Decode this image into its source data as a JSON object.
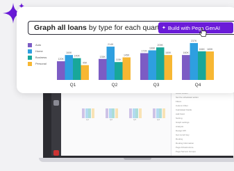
{
  "prompt": {
    "bold_text": "Graph all loans",
    "rest_text": "by type for each quarter",
    "button_label": "Build with Pega GenAI"
  },
  "colors": {
    "accent": "#6a1bd8",
    "auto": "#7c5cc4",
    "home": "#2e9fe0",
    "business": "#18a79a",
    "personal": "#f7b733"
  },
  "legend": [
    {
      "label": "Auto",
      "color": "#7c5cc4"
    },
    {
      "label": "Home",
      "color": "#2e9fe0"
    },
    {
      "label": "Business",
      "color": "#18a79a"
    },
    {
      "label": "Personal",
      "color": "#f7b733"
    }
  ],
  "chart_data": {
    "type": "bar",
    "categories": [
      "Q1",
      "Q2",
      "Q3",
      "Q4"
    ],
    "series": [
      {
        "name": "Auto",
        "values": [
          120,
          135,
          172,
          160
        ]
      },
      {
        "name": "Home",
        "values": [
          160,
          214,
          190,
          237
        ]
      },
      {
        "name": "Business",
        "values": [
          140,
          115,
          209,
          184
        ]
      },
      {
        "name": "Personal",
        "values": [
          95,
          145,
          160,
          183
        ]
      }
    ],
    "data_labels": [
      [
        "120K",
        "160K",
        "140K",
        "95K"
      ],
      [
        "135K",
        "214K",
        "115K",
        "145K"
      ],
      [
        "172K",
        "190K",
        "209K",
        "160K"
      ],
      [
        "160K",
        "237K",
        "184K",
        "183K"
      ]
    ],
    "ylim": [
      0,
      250
    ]
  },
  "laptop": {
    "panel_items": [
      "Action Button",
      "Set the scheduled action",
      "Filters",
      "Column Filter",
      "Calculated Fields",
      "Add Field",
      "Sorting",
      "Graph settings",
      "Analysis",
      "Design KPI",
      "Get record key",
      "Routing",
      "Routing Information",
      "Pega Infrastructure",
      "Pega Servers Groups"
    ],
    "mini_labels": [
      "Q1",
      "Q2",
      "Q3",
      "Q4"
    ]
  }
}
